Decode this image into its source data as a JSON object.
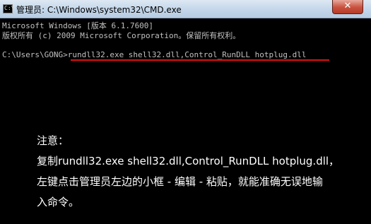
{
  "window": {
    "title": "管理员: C:\\Windows\\system32\\CMD.exe",
    "close_label": "✕"
  },
  "console": {
    "lines": [
      "Microsoft Windows [版本 6.1.7600]",
      "版权所有 (c) 2009 Microsoft Corporation。保留所有权利。",
      "C:\\Users\\GONG>rundll32.exe shell32.dll,Control_RunDLL hotplug.dll"
    ]
  },
  "annotation": {
    "heading": "注意：",
    "lines": [
      "复制rundll32.exe shell32.dll,Control_RunDLL hotplug.dll，",
      "左键点击管理员左边的小框 - 编辑 - 粘贴，就能准确无误地输",
      "入命令。"
    ],
    "underline_color": "#e01010"
  },
  "icons": [
    "cmd-window-icon",
    "close-icon"
  ]
}
